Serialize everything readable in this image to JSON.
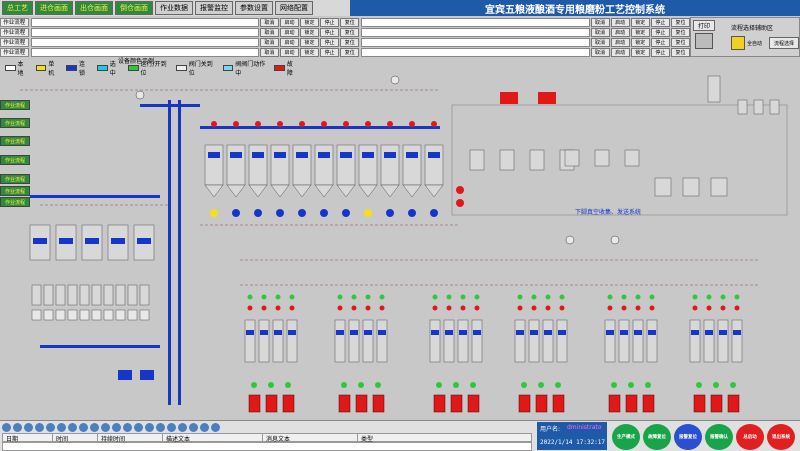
{
  "tabs": [
    "总工艺",
    "进仓画面",
    "出仓画面",
    "倒仓画面",
    "作业数据",
    "报警监控",
    "参数设置",
    "网络配置"
  ],
  "title": "宜宾五粮液酿酒专用粮磨粉工艺控制系统",
  "op_rows": {
    "label": "作业流程",
    "buttons": [
      "取消",
      "启动",
      "锁定",
      "停止",
      "复位"
    ]
  },
  "right_panel": {
    "print_label": "打印",
    "flow_title": "流程选择辅助区",
    "ch_a": "全自动",
    "ch_b": "流程选择"
  },
  "legend": {
    "title": "设备颜色示例",
    "items": [
      {
        "label": "本地",
        "color": "#ffffff"
      },
      {
        "label": "单机",
        "color": "#f4e01a"
      },
      {
        "label": "连锁",
        "color": "#1536c8"
      },
      {
        "label": "选中",
        "color": "#1ec8e8"
      },
      {
        "label": "运行/开到位",
        "color": "#2ec93a"
      },
      {
        "label": "阀门关到位",
        "color": "#eeeeee"
      },
      {
        "label": "阀阀门动作中",
        "color": "#78d8f0"
      },
      {
        "label": "故障",
        "color": "#e01818"
      }
    ]
  },
  "left_nav": [
    "作业流程",
    "作业流程",
    "作业流程",
    "作业流程",
    "作业流程",
    "作业流程",
    "作业流程"
  ],
  "diagram_labels": {
    "dust": "下脚真空收集、发送系统",
    "bottom_pl": [
      "PO2F1-01",
      "PO2F1-02",
      "PO2F1-03",
      "PO2F1-04",
      "PO2F2-01",
      "PO2F2-02"
    ],
    "silo_rows": [
      "DOY-1",
      "DOY-2",
      "DOY-3",
      "DOY-4",
      "DOY-5",
      "DOY-6",
      "DOY-7",
      "DOY-8",
      "DOY-9",
      "DOY-10",
      "DOY-11"
    ]
  },
  "alarm": {
    "columns": [
      "日期",
      "时间",
      "持续时间",
      "描述文本",
      "消息文本",
      "类型"
    ]
  },
  "user": {
    "label": "用户名:",
    "name": "dministrato",
    "datetime": "2022/1/14  17:32:17"
  },
  "control_buttons": [
    {
      "label": "生产模式",
      "color": "#1aa44a"
    },
    {
      "label": "故障复位",
      "color": "#1aa44a"
    },
    {
      "label": "报警复位",
      "color": "#2a4fd0"
    },
    {
      "label": "报警确认",
      "color": "#1aa44a"
    },
    {
      "label": "总启动",
      "color": "#e02020"
    },
    {
      "label": "退出系统",
      "color": "#e02020"
    }
  ]
}
